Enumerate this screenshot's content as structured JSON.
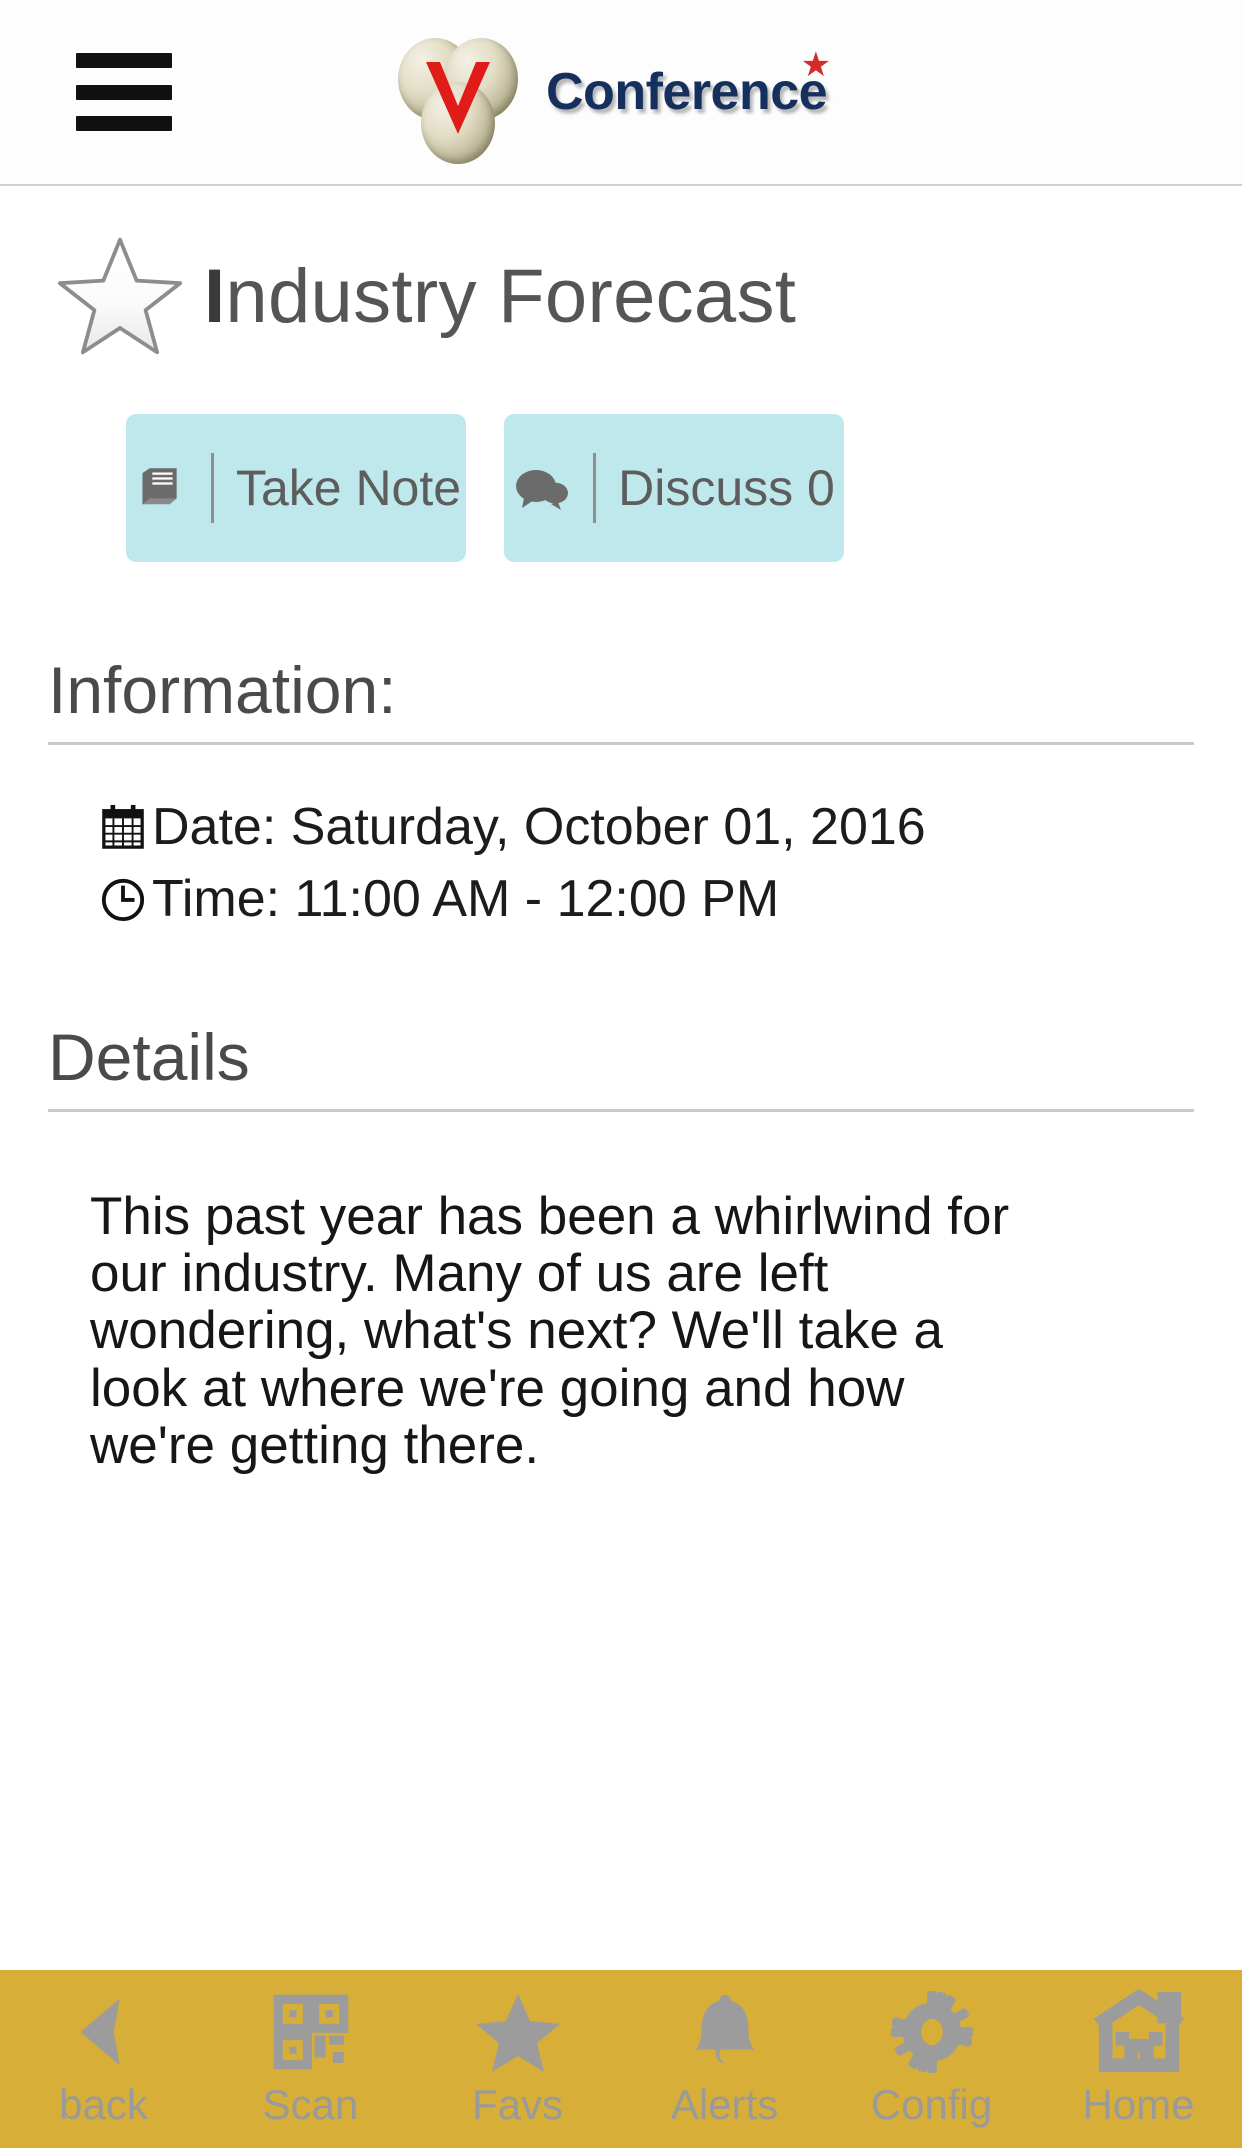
{
  "header": {
    "menu_icon": "hamburger-menu-icon",
    "logo_icon": "conference-logo-icon",
    "brand_text": "Conference",
    "brand_star": "★"
  },
  "session": {
    "favorite_icon": "star-outline-icon",
    "title_initial": "I",
    "title_rest": "ndustry Forecast",
    "title_full": "Industry Forecast"
  },
  "actions": [
    {
      "icon": "book-icon",
      "label": "Take Note"
    },
    {
      "icon": "chat-bubbles-icon",
      "label": "Discuss 0"
    }
  ],
  "information": {
    "heading": "Information:",
    "rows": [
      {
        "icon": "calendar-icon",
        "text": "Date: Saturday, October 01, 2016"
      },
      {
        "icon": "clock-icon",
        "text": "Time: 11:00 AM - 12:00 PM"
      }
    ]
  },
  "details": {
    "heading": "Details",
    "body": "This past year has been a whirlwind for our industry. Many of us are left wondering, what's next? We'll take a look at where we're going and how we're getting there."
  },
  "tabbar": {
    "background": "#d6ae38",
    "icon_color": "#9c9c9c",
    "items": [
      {
        "icon": "back-arrow-icon",
        "label": "back"
      },
      {
        "icon": "qr-scan-icon",
        "label": "Scan"
      },
      {
        "icon": "star-filled-icon",
        "label": "Favs"
      },
      {
        "icon": "bell-icon",
        "label": "Alerts"
      },
      {
        "icon": "gear-icon",
        "label": "Config"
      },
      {
        "icon": "home-icon",
        "label": "Home"
      }
    ]
  },
  "colors": {
    "accent_button": "#bfe8ec",
    "tabbar": "#d6ae38",
    "brand_navy": "#16305e",
    "brand_red": "#d32a2a"
  }
}
